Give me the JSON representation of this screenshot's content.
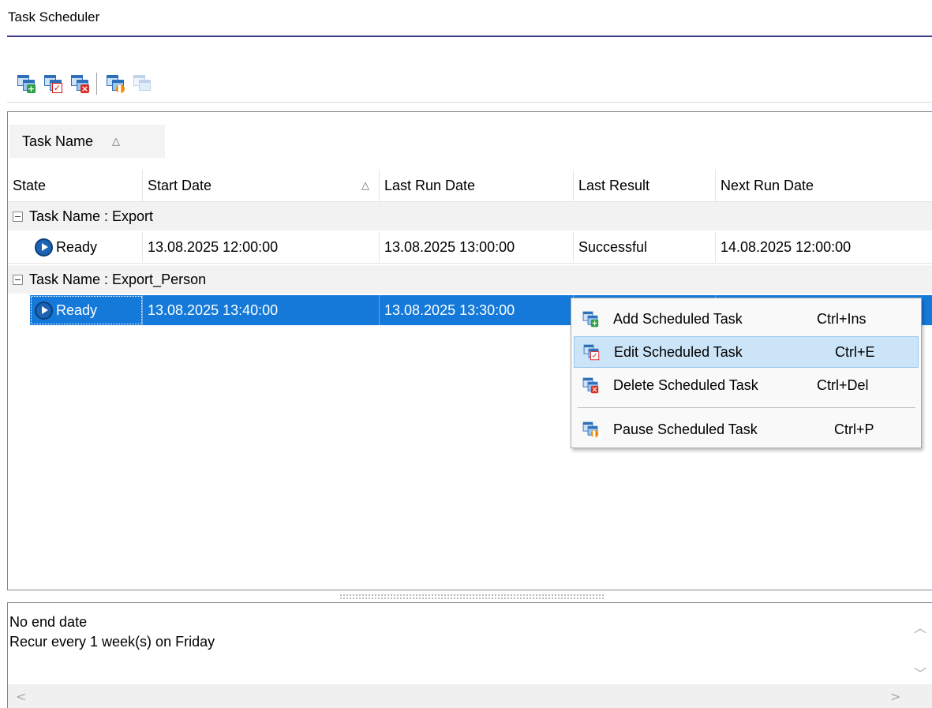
{
  "title": "Task Scheduler",
  "toolbar": {
    "buttons": [
      {
        "name": "add-scheduled-task",
        "icon": "add-task-icon"
      },
      {
        "name": "edit-scheduled-task",
        "icon": "edit-task-icon"
      },
      {
        "name": "delete-scheduled-task",
        "icon": "delete-task-icon"
      },
      {
        "name": "pause-scheduled-task",
        "icon": "pause-task-icon"
      },
      {
        "name": "resume-scheduled-task",
        "icon": "resume-task-icon",
        "disabled": true
      }
    ]
  },
  "grid": {
    "group_by_label": "Task Name",
    "columns": {
      "state": "State",
      "start_date": "Start Date",
      "last_run_date": "Last Run Date",
      "last_result": "Last Result",
      "next_run_date": "Next Run Date"
    },
    "groups": [
      {
        "label": "Task Name : Export",
        "row": {
          "state": "Ready",
          "start_date": "13.08.2025 12:00:00",
          "last_run_date": "13.08.2025 13:00:00",
          "last_result": "Successful",
          "next_run_date": "14.08.2025 12:00:00"
        }
      },
      {
        "label": "Task Name : Export_Person",
        "row": {
          "state": "Ready",
          "start_date": "13.08.2025 13:40:00",
          "last_run_date": "13.08.2025 13:30:00",
          "last_result": "",
          "next_run_date": ""
        },
        "selected": true
      }
    ]
  },
  "context_menu": {
    "items": [
      {
        "label": "Add Scheduled Task",
        "shortcut": "Ctrl+Ins",
        "icon": "add-task-icon"
      },
      {
        "label": "Edit Scheduled Task",
        "shortcut": "Ctrl+E",
        "icon": "edit-task-icon",
        "hovered": true
      },
      {
        "label": "Delete Scheduled Task",
        "shortcut": "Ctrl+Del",
        "icon": "delete-task-icon"
      },
      {
        "label": "Pause Scheduled Task",
        "shortcut": "Ctrl+P",
        "icon": "pause-task-icon"
      }
    ]
  },
  "details": {
    "line1": "No end date",
    "line2": "Recur every 1 week(s) on Friday"
  },
  "colors": {
    "selection": "#1479d8",
    "menu_hover": "#cce4f7",
    "title_rule": "#3b3b8f"
  }
}
